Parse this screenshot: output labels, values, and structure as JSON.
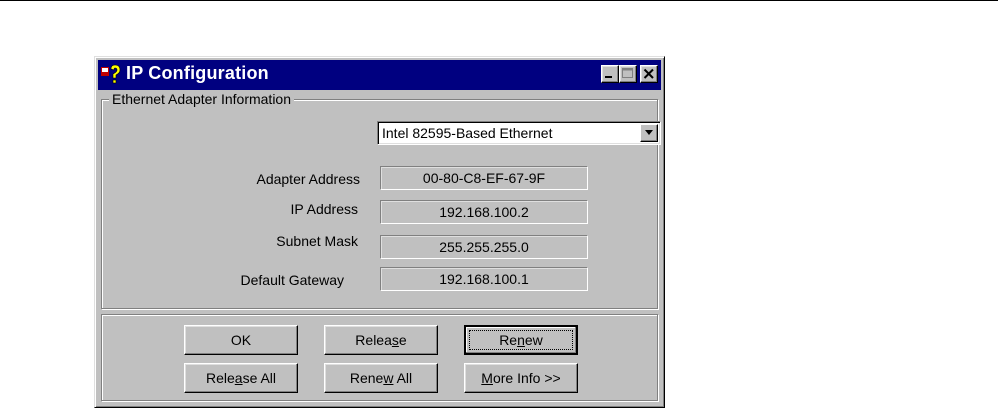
{
  "window": {
    "title": "IP Configuration"
  },
  "adapter_group": {
    "title": "Ethernet  Adapter Information",
    "adapter_select": {
      "selected": "Intel 82595-Based Ethernet"
    },
    "fields": [
      {
        "label": "Adapter Address",
        "value": "00-80-C8-EF-67-9F"
      },
      {
        "label": "IP Address",
        "value": "192.168.100.2"
      },
      {
        "label": "Subnet Mask",
        "value": "255.255.255.0"
      },
      {
        "label": "Default Gateway",
        "value": "192.168.100.1"
      }
    ]
  },
  "buttons": {
    "ok": {
      "label": "OK"
    },
    "release": {
      "pre": "Relea",
      "mnemonic": "s",
      "post": "e"
    },
    "renew": {
      "pre": "Re",
      "mnemonic": "n",
      "post": "ew"
    },
    "release_all": {
      "pre": "Rele",
      "mnemonic": "a",
      "post": "se All"
    },
    "renew_all": {
      "pre": "Rene",
      "mnemonic": "w",
      "post": " All"
    },
    "more_info": {
      "pre": "",
      "mnemonic": "M",
      "post": "ore Info >>"
    }
  },
  "colors": {
    "face": "#c0c0c0",
    "titlebar": "#000080",
    "title_text": "#ffffff"
  },
  "icons": {
    "app": "winipcfg-icon",
    "minimize": "minimize-icon",
    "maximize": "maximize-icon",
    "close": "close-icon",
    "dropdown": "dropdown-arrow-icon"
  }
}
